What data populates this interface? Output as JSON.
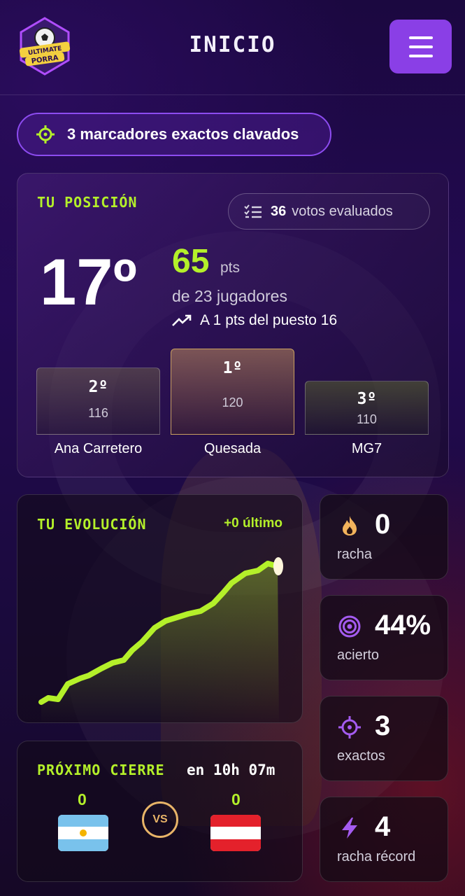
{
  "header": {
    "title": "INICIO",
    "logo_text_top": "ULTIMATE",
    "logo_text_bottom": "PORRA"
  },
  "banner": {
    "text": "3 marcadores exactos clavados",
    "icon": "crosshair-icon"
  },
  "position": {
    "label": "TU POSICIÓN",
    "votes_count": "36",
    "votes_text": "votos evaluados",
    "rank": "17º",
    "points": "65",
    "points_unit": "pts",
    "players_text": "de 23 jugadores",
    "gap_text": "A 1 pts del puesto 16",
    "podium": [
      {
        "rank": "1º",
        "points": "120",
        "name": "Quesada"
      },
      {
        "rank": "2º",
        "points": "116",
        "name": "Ana Carretero"
      },
      {
        "rank": "3º",
        "points": "110",
        "name": "MG7"
      }
    ]
  },
  "evolution": {
    "label": "TU EVOLUCIÓN",
    "delta": "+0 último",
    "line_color": "#b4f02a"
  },
  "next_close": {
    "label": "PRÓXIMO CIERRE",
    "time": "en 10h 07m",
    "home_score": "0",
    "away_score": "0",
    "vs": "VS",
    "home_flag": "argentina-flag",
    "away_flag": "austria-flag"
  },
  "stats": [
    {
      "value": "0",
      "label": "racha",
      "icon": "flame-icon"
    },
    {
      "value": "44%",
      "label": "acierto",
      "icon": "target-icon"
    },
    {
      "value": "3",
      "label": "exactos",
      "icon": "crosshair-icon"
    },
    {
      "value": "4",
      "label": "racha récord",
      "icon": "lightning-icon"
    }
  ],
  "colors": {
    "accent_green": "#b4f02a",
    "accent_purple": "#8a3fe6",
    "gold": "#e8b468"
  }
}
